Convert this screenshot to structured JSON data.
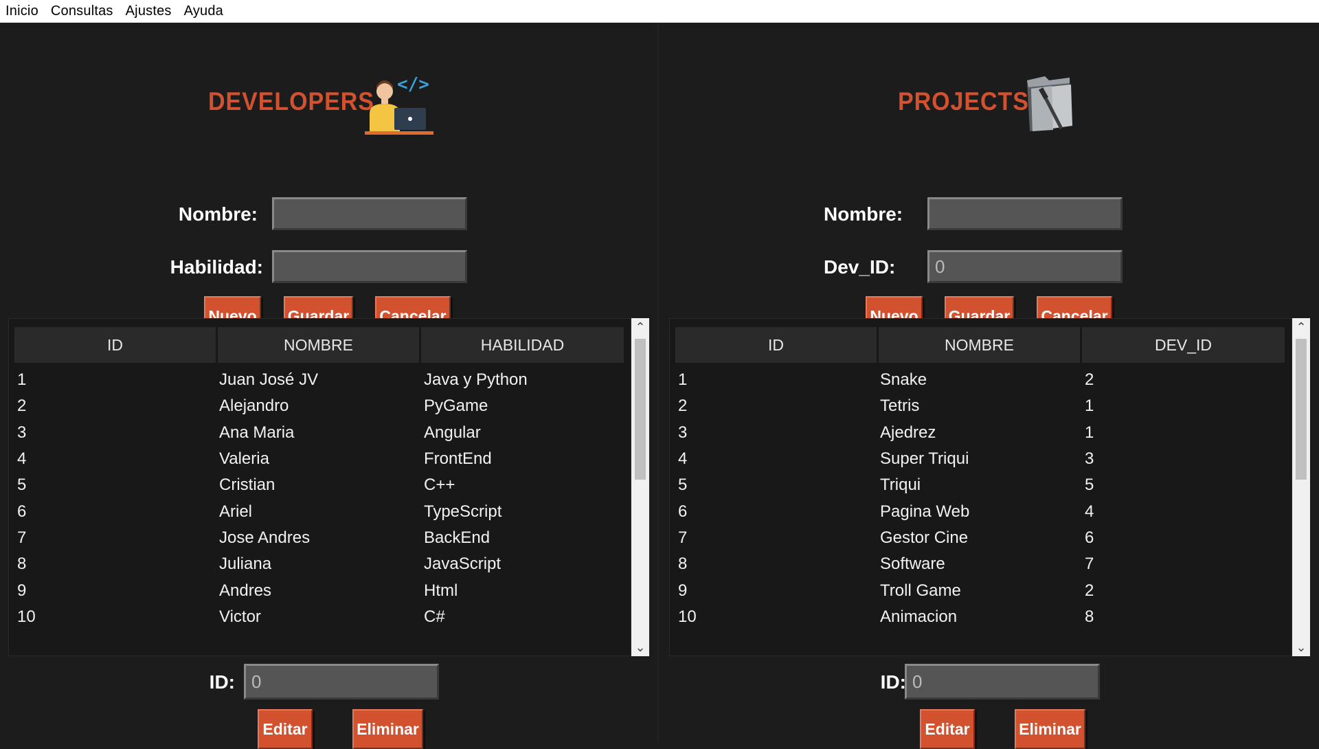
{
  "menu": [
    "Inicio",
    "Consultas",
    "Ajustes",
    "Ayuda"
  ],
  "colors": {
    "accent": "#d2512f",
    "background": "#1c1c1c",
    "field": "#555555"
  },
  "developers": {
    "title": "DEVELOPERS",
    "icon": "developer-laptop-icon",
    "labels": {
      "nombre": "Nombre:",
      "habilidad": "Habilidad:",
      "id": "ID:"
    },
    "values": {
      "nombre": "",
      "habilidad": "",
      "id": "0"
    },
    "buttons": {
      "nuevo": "Nuevo",
      "guardar": "Guardar",
      "cancelar": "Cancelar",
      "editar": "Editar",
      "eliminar": "Eliminar"
    },
    "columns": [
      "ID",
      "NOMBRE",
      "HABILIDAD"
    ],
    "rows": [
      [
        "1",
        "Juan José JV",
        "Java y Python"
      ],
      [
        "2",
        "Alejandro",
        "PyGame"
      ],
      [
        "3",
        "Ana Maria",
        "Angular"
      ],
      [
        "4",
        "Valeria",
        "FrontEnd"
      ],
      [
        "5",
        "Cristian",
        "C++"
      ],
      [
        "6",
        "Ariel",
        "TypeScript"
      ],
      [
        "7",
        "Jose Andres",
        "BackEnd"
      ],
      [
        "8",
        "Juliana",
        "JavaScript"
      ],
      [
        "9",
        "Andres",
        "Html"
      ],
      [
        "10",
        "Victor",
        "C#"
      ]
    ]
  },
  "projects": {
    "title": "PROJECTS",
    "icon": "project-folder-icon",
    "labels": {
      "nombre": "Nombre:",
      "dev_id": "Dev_ID:",
      "id": "ID:"
    },
    "values": {
      "nombre": "",
      "dev_id": "0",
      "id": "0"
    },
    "buttons": {
      "nuevo": "Nuevo",
      "guardar": "Guardar",
      "cancelar": "Cancelar",
      "editar": "Editar",
      "eliminar": "Eliminar"
    },
    "columns": [
      "ID",
      "NOMBRE",
      "DEV_ID"
    ],
    "rows": [
      [
        "1",
        "Snake",
        "2"
      ],
      [
        "2",
        "Tetris",
        "1"
      ],
      [
        "3",
        "Ajedrez",
        "1"
      ],
      [
        "4",
        "Super Triqui",
        "3"
      ],
      [
        "5",
        "Triqui",
        "5"
      ],
      [
        "6",
        "Pagina Web",
        "4"
      ],
      [
        "7",
        "Gestor Cine",
        "6"
      ],
      [
        "8",
        "Software",
        "7"
      ],
      [
        "9",
        "Troll Game",
        "2"
      ],
      [
        "10",
        "Animacion",
        "8"
      ]
    ]
  }
}
